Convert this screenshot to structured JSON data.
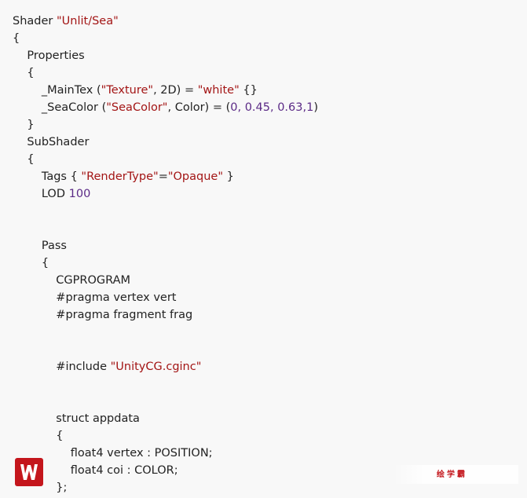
{
  "code": {
    "lines": [
      [
        {
          "t": "Shader ",
          "c": "plain"
        },
        {
          "t": "\"Unlit/Sea\"",
          "c": "str"
        }
      ],
      [
        {
          "t": "{",
          "c": "plain"
        }
      ],
      [
        {
          "t": "    Properties",
          "c": "plain"
        }
      ],
      [
        {
          "t": "    {",
          "c": "plain"
        }
      ],
      [
        {
          "t": "        _MainTex (",
          "c": "plain"
        },
        {
          "t": "\"Texture\"",
          "c": "str"
        },
        {
          "t": ", 2D) = ",
          "c": "plain"
        },
        {
          "t": "\"white\"",
          "c": "str"
        },
        {
          "t": " {}",
          "c": "plain"
        }
      ],
      [
        {
          "t": "        _SeaColor (",
          "c": "plain"
        },
        {
          "t": "\"SeaColor\"",
          "c": "str"
        },
        {
          "t": ", Color) = (",
          "c": "plain"
        },
        {
          "t": "0, 0.45, 0.63,1",
          "c": "num"
        },
        {
          "t": ")",
          "c": "plain"
        }
      ],
      [
        {
          "t": "    }",
          "c": "plain"
        }
      ],
      [
        {
          "t": "    SubShader",
          "c": "plain"
        }
      ],
      [
        {
          "t": "    {",
          "c": "plain"
        }
      ],
      [
        {
          "t": "        Tags { ",
          "c": "plain"
        },
        {
          "t": "\"RenderType\"",
          "c": "str"
        },
        {
          "t": "=",
          "c": "plain"
        },
        {
          "t": "\"Opaque\"",
          "c": "str"
        },
        {
          "t": " }",
          "c": "plain"
        }
      ],
      [
        {
          "t": "        LOD ",
          "c": "plain"
        },
        {
          "t": "100",
          "c": "num"
        }
      ],
      [],
      [],
      [
        {
          "t": "        Pass",
          "c": "plain"
        }
      ],
      [
        {
          "t": "        {",
          "c": "plain"
        }
      ],
      [
        {
          "t": "            CGPROGRAM",
          "c": "plain"
        }
      ],
      [
        {
          "t": "            #pragma vertex vert",
          "c": "plain"
        }
      ],
      [
        {
          "t": "            #pragma fragment frag",
          "c": "plain"
        }
      ],
      [],
      [],
      [
        {
          "t": "            #include ",
          "c": "plain"
        },
        {
          "t": "\"UnityCG.cginc\"",
          "c": "str"
        }
      ],
      [],
      [],
      [
        {
          "t": "            struct appdata",
          "c": "plain"
        }
      ],
      [
        {
          "t": "            {",
          "c": "plain"
        }
      ],
      [
        {
          "t": "                float4 vertex : POSITION;",
          "c": "plain"
        }
      ],
      [
        {
          "t": "                float4 coi : COLOR;",
          "c": "plain"
        }
      ],
      [
        {
          "t": "            };",
          "c": "plain"
        }
      ]
    ]
  },
  "watermark": {
    "text": "绘学霸",
    "logo_icon": "w-logo-icon",
    "brand_color": "#c4161c"
  },
  "colors": {
    "string": "#a31515",
    "number": "#5b2a86",
    "text": "#222222",
    "background": "#f8f8f8"
  }
}
